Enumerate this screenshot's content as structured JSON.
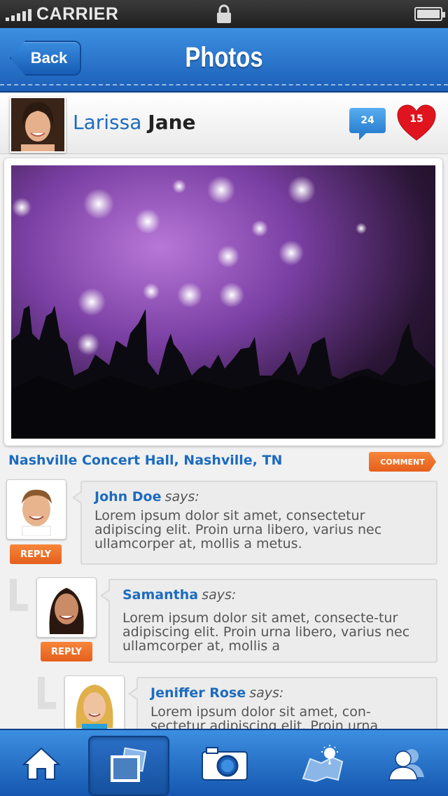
{
  "status_bar": {
    "carrier": "CARRIER",
    "icons": [
      "signal-bars-icon",
      "lock-icon",
      "battery-icon"
    ]
  },
  "nav": {
    "back_label": "Back",
    "title": "Photos"
  },
  "profile": {
    "first_name": "Larissa",
    "last_name": "Jane",
    "comment_count": "24",
    "like_count": "15"
  },
  "photo": {
    "location": "Nashville Concert Hall, Nashville, TN",
    "comment_label": "COMMENT"
  },
  "comments": [
    {
      "author": "John Doe",
      "says": "says:",
      "text": "Lorem ipsum dolor sit amet, consectetur adipiscing elit. Proin urna libero, varius nec ullamcorper at, mollis a metus.",
      "reply_label": "REPLY"
    },
    {
      "author": "Samantha",
      "says": "says:",
      "text": "Lorem ipsum dolor sit amet, consecte-tur adipiscing elit. Proin urna libero, varius nec ullamcorper at, mollis a",
      "reply_label": "REPLY"
    },
    {
      "author": "Jeniffer Rose",
      "says": "says:",
      "text": "Lorem ipsum dolor sit amet, con-sectetur adipiscing elit. Proin urna"
    }
  ],
  "tab_bar": {
    "tabs": [
      "home-icon",
      "photos-icon",
      "camera-icon",
      "map-icon",
      "friends-icon"
    ],
    "active": "photos-icon"
  },
  "colors": {
    "brand_blue": "#1c6bbf",
    "accent_orange": "#e5601c",
    "like_red": "#e0141e"
  }
}
